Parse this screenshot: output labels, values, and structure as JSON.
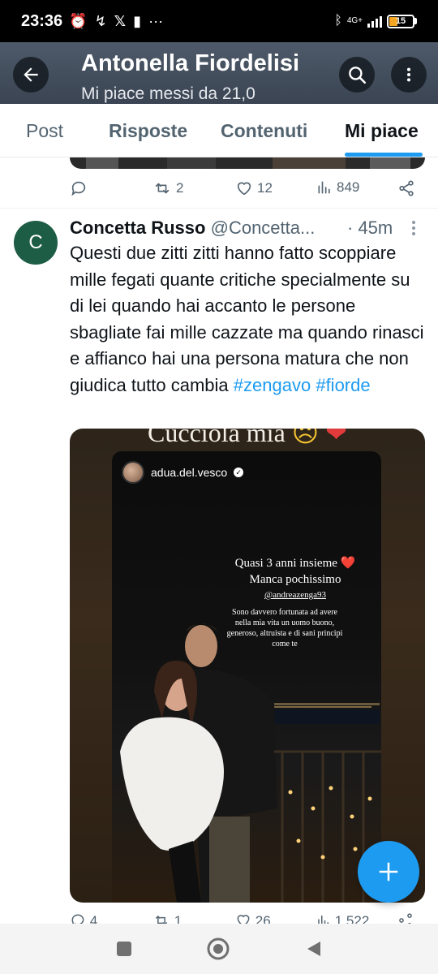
{
  "status_bar": {
    "time": "23:36",
    "network": "4G+",
    "battery": "15"
  },
  "header": {
    "title": "Antonella Fiordelisi",
    "subtitle": "Mi piace messi da 21,0"
  },
  "tabs": [
    {
      "label": "Post",
      "active": false
    },
    {
      "label": "Risposte",
      "active": false
    },
    {
      "label": "Contenuti",
      "active": false
    },
    {
      "label": "Mi piace",
      "active": true
    }
  ],
  "prev_tweet": {
    "replies": "",
    "reposts": "2",
    "likes": "12",
    "views": "849"
  },
  "tweet": {
    "avatar_letter": "C",
    "avatar_color": "#1d5c45",
    "name": "Concetta Russo",
    "handle": "@Concetta...",
    "time": "· 45m",
    "text": "Questi due zitti zitti hanno fatto scoppiare mille fegati quante critiche specialmente su di lei quando hai accanto le persone sbagliate fai mille cazzate ma quando rinasci e affianco hai una persona matura che non giudica tutto cambia ",
    "hashtag1": "#zengavo",
    "hashtag2": "#fiorde",
    "media": {
      "caption": "Cucciola mia",
      "story_user": "adua.del.vesco",
      "story_line1": "Quasi 3 anni insieme ❤️",
      "story_line2": "Manca pochissimo",
      "story_mention": "@andreazenga93",
      "story_text": "Sono davvero fortunata ad avere nella mia vita un uomo buono, generoso, altruista e di sani principi come te"
    }
  },
  "next_actions": {
    "replies": "4",
    "reposts": "1",
    "likes": "26",
    "views": "1.522"
  },
  "colors": {
    "accent": "#1d9bf0",
    "text": "#0f1419",
    "muted": "#536471"
  }
}
